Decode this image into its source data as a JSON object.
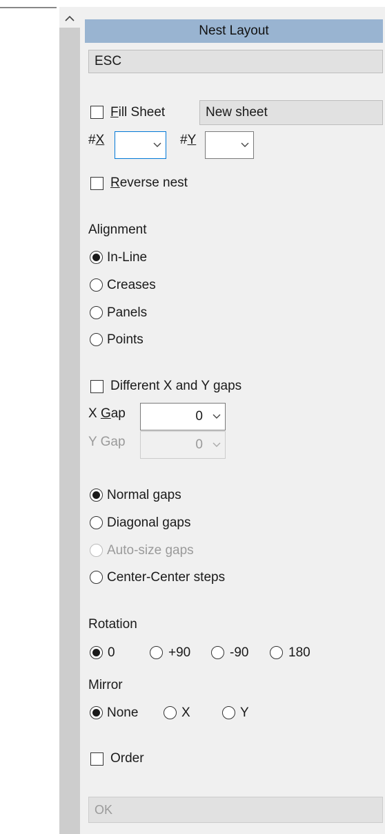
{
  "panel": {
    "title": "Nest Layout",
    "esc_label": "ESC",
    "fill_sheet": {
      "label_accel": "F",
      "label_rest": "ill Sheet",
      "checked": false
    },
    "sheet_name": "New sheet",
    "nx": {
      "label_prefix": "#",
      "label_accel": "X",
      "value": ""
    },
    "ny": {
      "label_prefix": "#",
      "label_accel": "Y",
      "value": ""
    },
    "reverse_nest": {
      "label_accel": "R",
      "label_rest": "everse nest",
      "checked": false
    },
    "alignment": {
      "heading": "Alignment",
      "options": [
        "In-Line",
        "Creases",
        "Panels",
        "Points"
      ],
      "selected": "In-Line"
    },
    "different_gaps": {
      "label": "Different X and Y gaps",
      "checked": false
    },
    "x_gap": {
      "label_prefix": "X ",
      "label_accel": "G",
      "label_rest": "ap",
      "value": "0"
    },
    "y_gap": {
      "label": "Y Gap",
      "value": "0",
      "disabled": true
    },
    "gap_mode": {
      "options": [
        "Normal gaps",
        "Diagonal gaps",
        "Auto-size gaps",
        "Center-Center steps"
      ],
      "selected": "Normal gaps",
      "disabled": [
        "Auto-size gaps"
      ]
    },
    "rotation": {
      "heading": "Rotation",
      "options": [
        "0",
        "+90",
        "-90",
        "180"
      ],
      "selected": "0"
    },
    "mirror": {
      "heading": "Mirror",
      "options": [
        "None",
        "X",
        "Y"
      ],
      "selected": "None"
    },
    "order": {
      "label": "Order",
      "checked": false
    },
    "ok_label": "OK"
  },
  "colors": {
    "title_bar": "#99b4d1",
    "panel_bg": "#f0f0f0",
    "focus_border": "#0078d7",
    "disabled_text": "#9a9a9a"
  },
  "icons": {
    "scroll_up": "chevron-up-icon",
    "dropdown": "chevron-down-icon"
  }
}
